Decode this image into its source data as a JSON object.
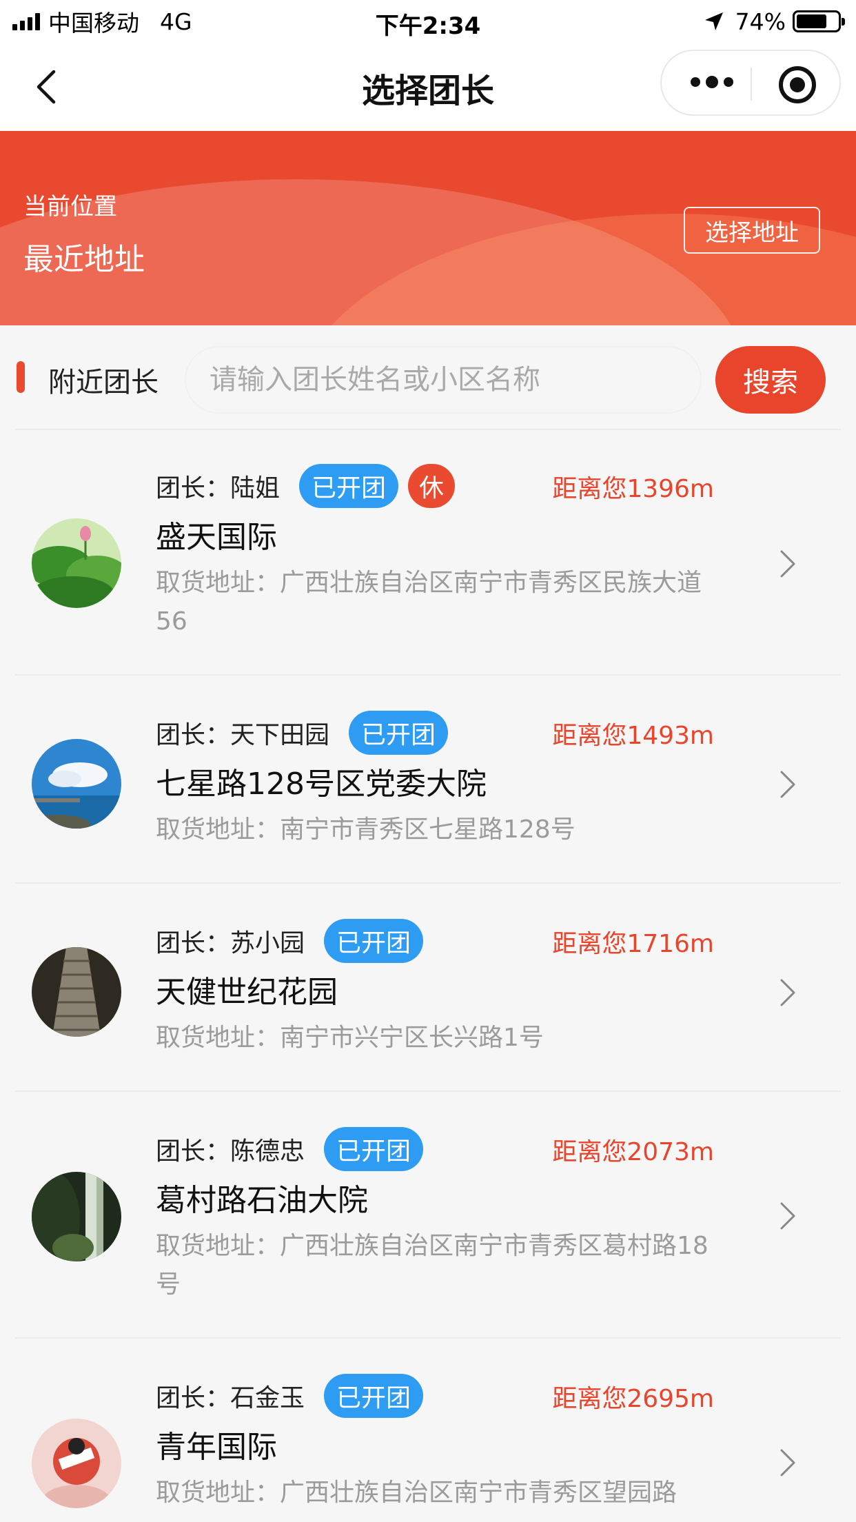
{
  "status_bar": {
    "carrier": "中国移动",
    "network": "4G",
    "time": "下午2:34",
    "battery_percent": "74%",
    "battery_level": 0.74
  },
  "nav": {
    "title": "选择团长",
    "back_icon": "chevron-left-icon",
    "more_icon": "more-dots-icon",
    "close_icon": "target-close-icon"
  },
  "banner": {
    "current_location_label": "当前位置",
    "current_address": "最近地址",
    "choose_address_button": "选择地址",
    "color": "#e9492f"
  },
  "search": {
    "section_label": "附近团长",
    "placeholder": "请输入团长姓名或小区名称",
    "button_label": "搜索"
  },
  "leaders": [
    {
      "leader_label": "团长：",
      "leader_name": "陆姐",
      "status_tag": "已开团",
      "rest_tag": "休",
      "distance": "距离您1396m",
      "community": "盛天国际",
      "pickup": "取货地址：广西壮族自治区南宁市青秀区民族大道56",
      "avatar": "lotus-photo"
    },
    {
      "leader_label": "团长：",
      "leader_name": "天下田园",
      "status_tag": "已开团",
      "distance": "距离您1493m",
      "community": "七星路128号区党委大院",
      "pickup": "取货地址：南宁市青秀区七星路128号",
      "avatar": "sky-pier-photo"
    },
    {
      "leader_label": "团长：",
      "leader_name": "苏小园",
      "status_tag": "已开团",
      "distance": "距离您1716m",
      "community": "天健世纪花园",
      "pickup": "取货地址：南宁市兴宁区长兴路1号",
      "avatar": "stairs-photo"
    },
    {
      "leader_label": "团长：",
      "leader_name": "陈德忠",
      "status_tag": "已开团",
      "distance": "距离您2073m",
      "community": "葛村路石油大院",
      "pickup": "取货地址：广西壮族自治区南宁市青秀区葛村路18号",
      "avatar": "waterfall-photo"
    },
    {
      "leader_label": "团长：",
      "leader_name": "石金玉",
      "status_tag": "已开团",
      "distance": "距离您2695m",
      "community": "青年国际",
      "pickup": "取货地址：广西壮族自治区南宁市青秀区望园路",
      "avatar": "illustration-photo"
    }
  ]
}
